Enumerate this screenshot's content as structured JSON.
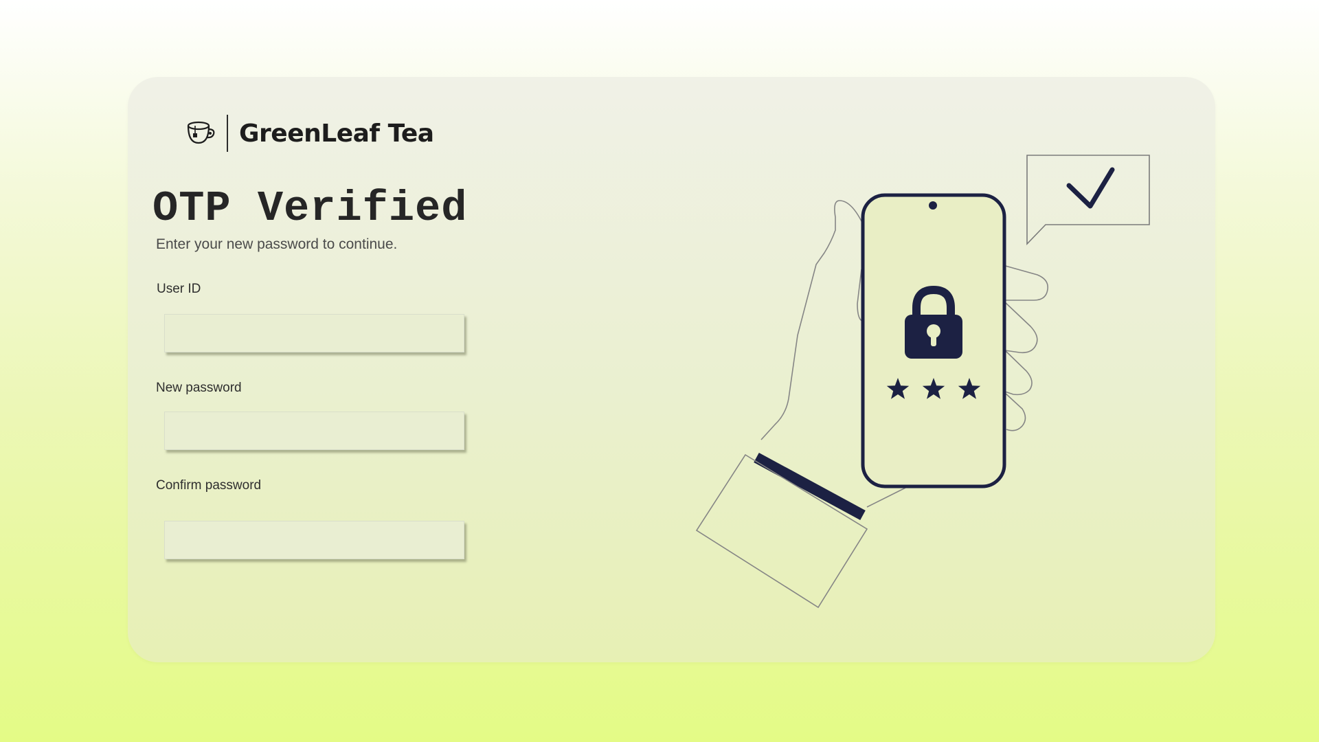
{
  "brand": {
    "name": "GreenLeaf Tea",
    "logo_icon": "teacup-icon"
  },
  "page": {
    "title": "OTP Verified",
    "subtitle": "Enter your new password to continue."
  },
  "form": {
    "user_id": {
      "label": "User ID",
      "value": "",
      "placeholder": ""
    },
    "new_password": {
      "label": "New password",
      "value": "",
      "placeholder": ""
    },
    "confirm_password": {
      "label": "Confirm password",
      "value": "",
      "placeholder": ""
    }
  },
  "illustration": {
    "icons": [
      "hand-holding-phone-icon",
      "padlock-icon",
      "star-icon",
      "checkmark-speech-bubble-icon"
    ]
  },
  "colors": {
    "accent_navy": "#1c2143",
    "text_dark": "#262626",
    "background_lime": "#e4fb86"
  }
}
